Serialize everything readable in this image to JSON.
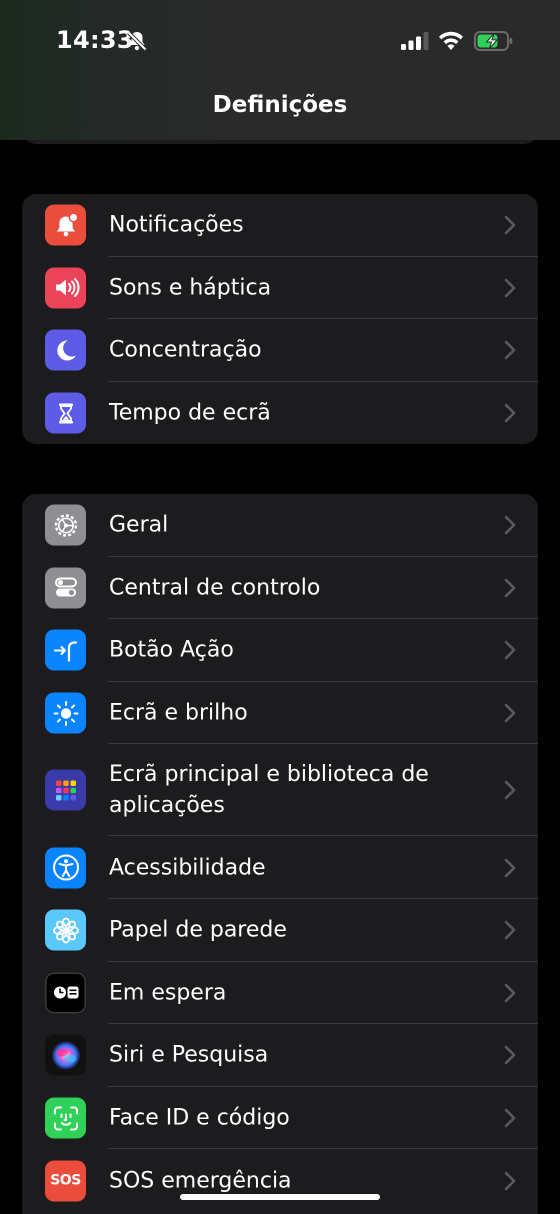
{
  "status": {
    "time": "14:33"
  },
  "header": {
    "title": "Definições"
  },
  "colors": {
    "red": "#eb4d3d",
    "pink": "#eb445a",
    "indigo": "#5e5ce6",
    "gray": "#8e8e93",
    "blue": "#0a84ff",
    "teal": "#5ac8fa",
    "green": "#30d158",
    "black": "#000000"
  },
  "group1": {
    "items": [
      {
        "label": "Notificações",
        "icon": "bell-badge-icon"
      },
      {
        "label": "Sons e háptica",
        "icon": "speaker-icon"
      },
      {
        "label": "Concentração",
        "icon": "moon-icon"
      },
      {
        "label": "Tempo de ecrã",
        "icon": "hourglass-icon"
      }
    ]
  },
  "group2": {
    "items": [
      {
        "label": "Geral",
        "icon": "gear-icon"
      },
      {
        "label": "Central de controlo",
        "icon": "toggles-icon"
      },
      {
        "label": "Botão Ação",
        "icon": "action-button-icon"
      },
      {
        "label": "Ecrã e brilho",
        "icon": "sun-icon"
      },
      {
        "label": "Ecrã principal e biblioteca de aplicações",
        "icon": "app-grid-icon"
      },
      {
        "label": "Acessibilidade",
        "icon": "accessibility-icon"
      },
      {
        "label": "Papel de parede",
        "icon": "flower-icon"
      },
      {
        "label": "Em espera",
        "icon": "standby-icon"
      },
      {
        "label": "Siri e Pesquisa",
        "icon": "siri-icon"
      },
      {
        "label": "Face ID e código",
        "icon": "face-id-icon"
      },
      {
        "label": "SOS emergência",
        "icon": "sos-icon",
        "icon_text": "SOS"
      }
    ]
  }
}
